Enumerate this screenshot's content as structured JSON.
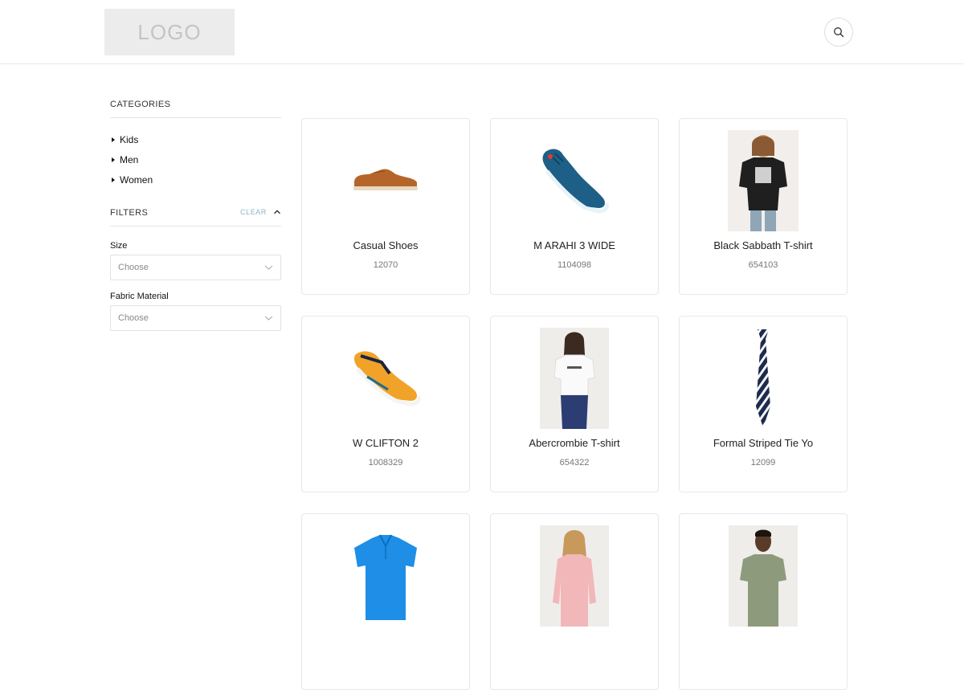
{
  "header": {
    "logo_text": "LOGO"
  },
  "sidebar": {
    "categories_title": "CATEGORIES",
    "categories": [
      {
        "label": "Kids"
      },
      {
        "label": "Men"
      },
      {
        "label": "Women"
      }
    ],
    "filters_title": "FILTERS",
    "clear_label": "CLEAR",
    "filters": [
      {
        "label": "Size",
        "placeholder": "Choose"
      },
      {
        "label": "Fabric Material",
        "placeholder": "Choose"
      }
    ]
  },
  "products": [
    {
      "name": "Casual Shoes",
      "sku": "12070",
      "image": "brown-suede-shoe"
    },
    {
      "name": "M ARAHI 3 WIDE",
      "sku": "1104098",
      "image": "blue-running-shoe"
    },
    {
      "name": "Black Sabbath T-shirt",
      "sku": "654103",
      "image": "man-band-tshirt"
    },
    {
      "name": "W CLIFTON 2",
      "sku": "1008329",
      "image": "orange-running-shoe"
    },
    {
      "name": "Abercrombie T-shirt",
      "sku": "654322",
      "image": "woman-white-tshirt"
    },
    {
      "name": "Formal Striped Tie Yo",
      "sku": "12099",
      "image": "striped-tie"
    },
    {
      "name": "",
      "sku": "",
      "image": "blue-polo-shirt"
    },
    {
      "name": "",
      "sku": "",
      "image": "woman-pink-longsleeve"
    },
    {
      "name": "",
      "sku": "",
      "image": "man-green-tshirt"
    }
  ],
  "colors": {
    "accent_link": "#8fb3c6",
    "border": "#e4e9eb"
  }
}
